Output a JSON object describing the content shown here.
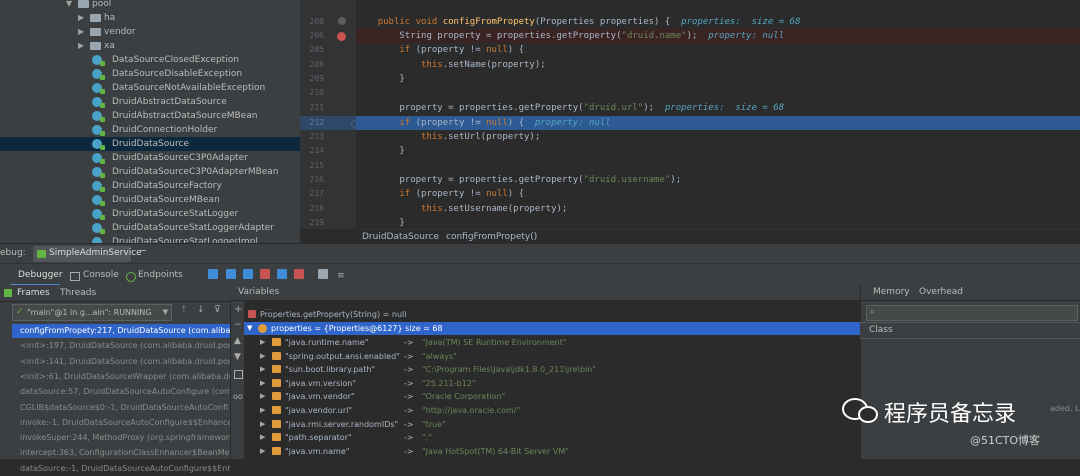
{
  "tree": {
    "items": [
      {
        "label": "pool",
        "kind": "folder",
        "depth": 0,
        "open": true
      },
      {
        "label": "ha",
        "kind": "folder",
        "depth": 1,
        "open": false
      },
      {
        "label": "vendor",
        "kind": "folder",
        "depth": 1,
        "open": false
      },
      {
        "label": "xa",
        "kind": "folder",
        "depth": 1,
        "open": false
      },
      {
        "label": "DataSourceClosedException",
        "kind": "class",
        "depth": 2
      },
      {
        "label": "DataSourceDisableException",
        "kind": "class",
        "depth": 2
      },
      {
        "label": "DataSourceNotAvailableException",
        "kind": "class",
        "depth": 2
      },
      {
        "label": "DruidAbstractDataSource",
        "kind": "class",
        "depth": 2
      },
      {
        "label": "DruidAbstractDataSourceMBean",
        "kind": "class",
        "depth": 2
      },
      {
        "label": "DruidConnectionHolder",
        "kind": "class",
        "depth": 2
      },
      {
        "label": "DruidDataSource",
        "kind": "class",
        "depth": 2,
        "selected": true
      },
      {
        "label": "DruidDataSourceC3P0Adapter",
        "kind": "class",
        "depth": 2
      },
      {
        "label": "DruidDataSourceC3P0AdapterMBean",
        "kind": "class",
        "depth": 2
      },
      {
        "label": "DruidDataSourceFactory",
        "kind": "class",
        "depth": 2
      },
      {
        "label": "DruidDataSourceMBean",
        "kind": "class",
        "depth": 2
      },
      {
        "label": "DruidDataSourceStatLogger",
        "kind": "class",
        "depth": 2
      },
      {
        "label": "DruidDataSourceStatLoggerAdapter",
        "kind": "class",
        "depth": 2
      },
      {
        "label": "DruidDataSourceStatLoggerImpl",
        "kind": "class",
        "depth": 2
      }
    ]
  },
  "editor": {
    "lines": [
      {
        "num": "208",
        "state": "normal"
      },
      {
        "num": "206",
        "state": "error"
      },
      {
        "num": "205",
        "state": "normal"
      },
      {
        "num": "208",
        "state": "normal"
      },
      {
        "num": "209",
        "state": "normal"
      },
      {
        "num": "210",
        "state": "normal"
      },
      {
        "num": "211",
        "state": "normal"
      },
      {
        "num": "212",
        "state": "current"
      },
      {
        "num": "213",
        "state": "normal"
      },
      {
        "num": "214",
        "state": "normal"
      },
      {
        "num": "215",
        "state": "normal"
      },
      {
        "num": "216",
        "state": "normal"
      },
      {
        "num": "217",
        "state": "normal"
      },
      {
        "num": "218",
        "state": "normal"
      },
      {
        "num": "219",
        "state": "normal"
      },
      {
        "num": "217",
        "state": "normal"
      }
    ],
    "code": {
      "l0_kw1": "public ",
      "l0_kw2": "void ",
      "l0_fn": "configFromPropety",
      "l0_rest": "(Properties properties) {  ",
      "l0_hint": "properties:  size = 68",
      "l1_a": "String property = properties.getProperty(",
      "l1_str": "\"druid.name\"",
      "l1_b": ");  ",
      "l1_hint": "property: null",
      "l2_kw": "if ",
      "l2_a": "(property != ",
      "l2_kw2": "null",
      "l2_b": ") {",
      "l3_kw": "this",
      "l3_a": ".setName(property);",
      "l4": "}",
      "l6_a": "property = properties.getProperty(",
      "l6_str": "\"druid.url\"",
      "l6_b": ");  ",
      "l6_hint": "properties:  size = 68",
      "l7_kw": "if ",
      "l7_a": "(property != ",
      "l7_kw2": "null",
      "l7_b": ") {  ",
      "l7_hint": "property: null",
      "l8_kw": "this",
      "l8_a": ".setUrl(property);",
      "l9": "}",
      "l11_a": "property = properties.getProperty(",
      "l11_str": "\"druid.username\"",
      "l11_b": ");",
      "l12_kw": "if ",
      "l12_a": "(property != ",
      "l12_kw2": "null",
      "l12_b": ") {",
      "l13_kw": "this",
      "l13_a": ".setUsername(property);",
      "l14": "}"
    },
    "breadcrumb": {
      "cls": "DruidDataSource",
      "method": "configFromPropety()"
    }
  },
  "debug": {
    "label": "ebug:",
    "config": "SimpleAdminService",
    "tabs": [
      "Debugger",
      "Console",
      "Endpoints"
    ],
    "frames_tab": "Frames",
    "threads_tab": "Threads",
    "variables_tab": "Variables",
    "thread_select": "\"main\"@1 in g...ain\": RUNNING",
    "frames": [
      "configFromPropety:217, DruidDataSource (com.alibaba",
      "<init>:197, DruidDataSource (com.alibaba.druid.pool)",
      "<init>:141, DruidDataSource (com.alibaba.druid.pool)",
      "<init>:61, DruidDataSourceWrapper (com.alibaba.dr",
      "dataSource:57, DruidDataSourceAutoConfigure (com.",
      "CGLIB$dataSource$0:-1, DruidDataSourceAutoConfi",
      "invoke:-1, DruidDataSourceAutoConfigure$$EnhancerB",
      "invokeSuper:244, MethodProxy (org.springframework",
      "intercept:363, ConfigurationClassEnhancer$BeanMeth",
      "dataSource:-1, DruidDataSourceAutoConfigure$$Enh"
    ],
    "vars_top": "Properties.getProperty(String) = null",
    "vars_main": "properties = {Properties@6127}  size = 68",
    "vars": [
      {
        "k": "\"java.runtime.name\"",
        "v": "\"Java(TM) SE Runtime Environment\""
      },
      {
        "k": "\"spring.output.ansi.enabled\"",
        "v": "\"always\""
      },
      {
        "k": "\"sun.boot.library.path\"",
        "v": "\"C:\\Program Files\\Java\\jdk1.8.0_211\\jre\\bin\""
      },
      {
        "k": "\"java.vm.version\"",
        "v": "\"25.211-b12\""
      },
      {
        "k": "\"java.vm.vendor\"",
        "v": "\"Oracle Corporation\""
      },
      {
        "k": "\"java.vendor.url\"",
        "v": "\"http://java.oracle.com/\""
      },
      {
        "k": "\"java.rmi.server.randomIDs\"",
        "v": "\"true\""
      },
      {
        "k": "\"path.separator\"",
        "v": "\";\""
      },
      {
        "k": "\"java.vm.name\"",
        "v": "\"Java HotSpot(TM) 64-Bit Server VM\""
      }
    ],
    "memory_tab": "Memory",
    "overhead_tab": "Overhead",
    "class_col": "Class",
    "loaded_hint": "aded. L"
  },
  "watermark": {
    "title": "程序员备忘录",
    "sub": "@51CTO博客"
  },
  "colors": {
    "selection": "#2f65ca",
    "current_line": "#2d5a92",
    "tree_selection": "#0d293e"
  }
}
